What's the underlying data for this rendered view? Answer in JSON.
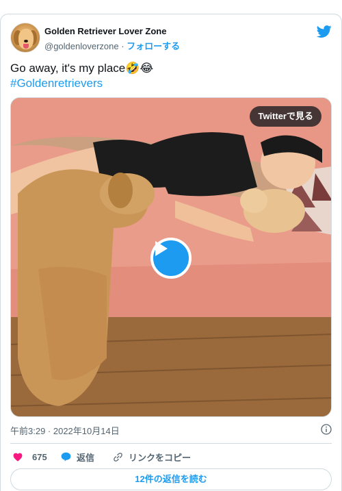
{
  "account": {
    "name": "Golden Retriever Lover Zone",
    "handle": "@goldenloverzone",
    "separator": " · ",
    "follow_label": "フォローする"
  },
  "tweet": {
    "text": "Go away, it's my place🤣😂",
    "hashtag": "#Goldenretrievers"
  },
  "media": {
    "watch_label": "Twitterで見る"
  },
  "meta": {
    "timestamp": "午前3:29 · 2022年10月14日"
  },
  "actions": {
    "likes": "675",
    "reply_label": "返信",
    "copy_link_label": "リンクをコピー"
  },
  "replies_button": "12件の返信を読む",
  "colors": {
    "accent": "#1d9bf0",
    "like": "#f91880",
    "text": "#0f1419",
    "muted": "#536471",
    "border": "#cfd9de"
  },
  "icons": [
    "twitter-logo-icon",
    "play-icon",
    "info-icon",
    "heart-icon",
    "reply-bubble-icon",
    "link-icon"
  ]
}
